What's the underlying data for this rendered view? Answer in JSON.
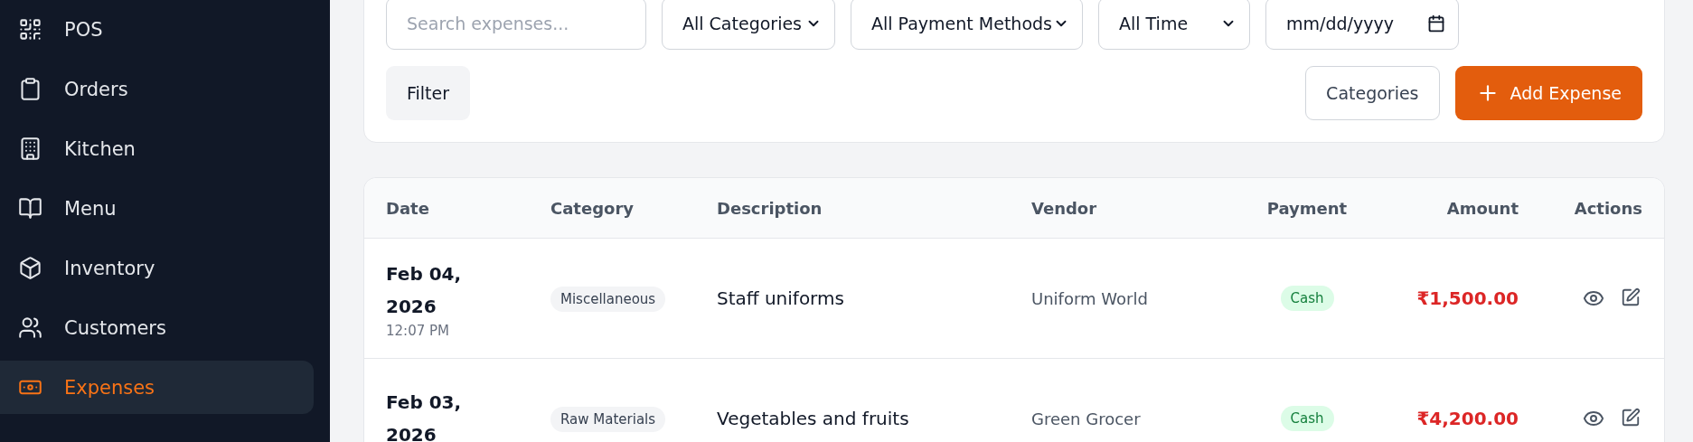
{
  "sidebar": {
    "items": [
      {
        "kind": "pos",
        "label": "POS",
        "selected": false
      },
      {
        "kind": "orders",
        "label": "Orders",
        "selected": false
      },
      {
        "kind": "kitchen",
        "label": "Kitchen",
        "selected": false
      },
      {
        "kind": "menu",
        "label": "Menu",
        "selected": false
      },
      {
        "kind": "inventory",
        "label": "Inventory",
        "selected": false
      },
      {
        "kind": "customers",
        "label": "Customers",
        "selected": false
      },
      {
        "kind": "expenses",
        "label": "Expenses",
        "selected": true
      }
    ]
  },
  "filters": {
    "search": {
      "placeholder": "Search expenses..."
    },
    "selects": [
      {
        "value": "All Categories"
      },
      {
        "value": "All Payment Methods"
      },
      {
        "value": "All Time"
      }
    ],
    "date": {
      "placeholder": "mm/dd/yyyy"
    },
    "filter_button": "Filter",
    "categories_button": "Categories",
    "add_button": "Add Expense"
  },
  "table": {
    "columns": [
      "Date",
      "Category",
      "Description",
      "Vendor",
      "Payment",
      "Amount",
      "Actions"
    ],
    "rows": [
      {
        "date": "Feb 04, 2026",
        "time": "12:07 PM",
        "category": "Miscellaneous",
        "description": "Staff uniforms",
        "vendor": "Uniform World",
        "payment": "Cash",
        "amount": "₹1,500.00"
      },
      {
        "date": "Feb 03, 2026",
        "category": "Raw Materials",
        "description": "Vegetables and fruits",
        "vendor": "Green Grocer",
        "payment": "Cash",
        "amount": "₹4,200.00"
      }
    ]
  }
}
